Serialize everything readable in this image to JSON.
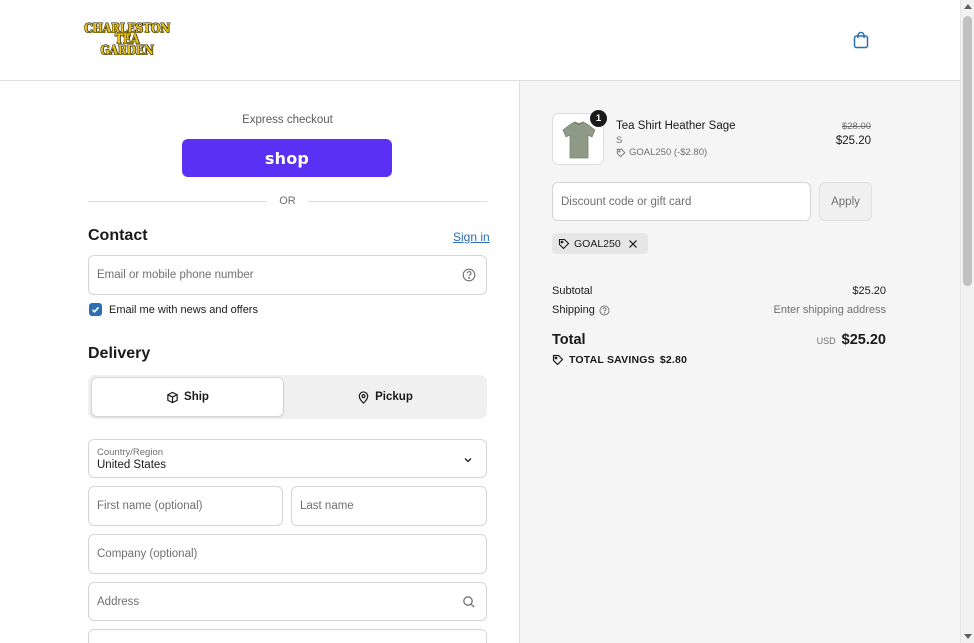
{
  "header": {
    "logo_lines": [
      "CHARLESTON",
      "TEA",
      "GARDEN"
    ]
  },
  "express": {
    "label": "Express checkout",
    "shop_button": "shop",
    "or_divider": "OR"
  },
  "contact": {
    "title": "Contact",
    "sign_in": "Sign in",
    "email_placeholder": "Email or mobile phone number",
    "newsletter_label": "Email me with news and offers",
    "newsletter_checked": true
  },
  "delivery": {
    "title": "Delivery",
    "options": [
      {
        "label": "Ship",
        "selected": true
      },
      {
        "label": "Pickup",
        "selected": false
      }
    ],
    "country_label": "Country/Region",
    "country_value": "United States",
    "first_name_placeholder": "First name (optional)",
    "last_name_placeholder": "Last name",
    "company_placeholder": "Company (optional)",
    "address_placeholder": "Address"
  },
  "summary": {
    "item": {
      "quantity": "1",
      "name": "Tea Shirt Heather Sage",
      "variant": "S",
      "discount": "GOAL250 (-$2.80)",
      "original_price": "$28.00",
      "price": "$25.20"
    },
    "discount_placeholder": "Discount code or gift card",
    "apply_label": "Apply",
    "applied_code": "GOAL250",
    "subtotal_label": "Subtotal",
    "subtotal_value": "$25.20",
    "shipping_label": "Shipping",
    "shipping_value": "Enter shipping address",
    "total_label": "Total",
    "total_currency": "USD",
    "total_value": "$25.20",
    "savings_label": "TOTAL SAVINGS",
    "savings_value": "$2.80"
  },
  "colors": {
    "accent": "#2a6fb5",
    "shop_purple": "#5a31f4",
    "summary_bg": "#f5f5f5"
  }
}
